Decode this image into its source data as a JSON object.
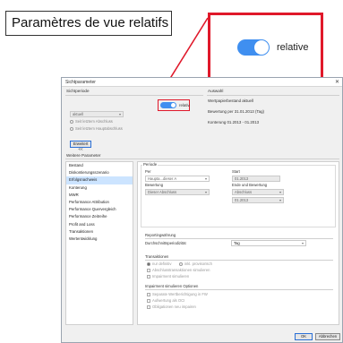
{
  "callout": {
    "title": "Paramètres de vue relatifs"
  },
  "zoom": {
    "toggle_label": "relative"
  },
  "dialog": {
    "title": "Sichtparameter",
    "sichtperiode_label": "Sichtperiode",
    "toggle_label": "relativ",
    "period_select_value": "aktuell",
    "radio_1": "Seit letztem Abschluss",
    "radio_2": "Seit letztem Hauptabschluss",
    "erweitert_button": "Erweitert <<",
    "auswahl_label": "Auswahl",
    "auswahl_lines": [
      "Wertpapierbestand aktuell",
      "Bewertung per 31.01.2013 (Tag)",
      "Konterung 01.2013 - 01.2013"
    ],
    "weitere_label": "Weitere Parameter",
    "ok_button": "OK",
    "cancel_button": "Abbrechen"
  },
  "nav": {
    "items": [
      "Bestand",
      "Diskontierungsszenario",
      "Erfolgsnachweis",
      "Konterung",
      "MWR",
      "Performance Attribution",
      "Performance Quervergleich",
      "Performance Zeitreihe",
      "Profit and Loss",
      "Transaktionen",
      "Wertentwicklung"
    ],
    "active_index": 2
  },
  "content": {
    "periode_title": "Periode",
    "per_label": "Per",
    "per_value": "Haupta...dieser A",
    "bewertung_label": "Bewertung",
    "bewertung_value": "Dieser Abschluss",
    "start_label": "Start",
    "start_value": "01.2013",
    "ende_label": "Ende und Bewertung",
    "ende_select": "Abschluss",
    "ende_value": "01.2013",
    "reporting_title": "Reportingwährung",
    "durchschnitt_label": "Durchschnittsperiodizität",
    "durchschnitt_value": "Tag",
    "transaktionen_title": "Transaktionen",
    "trans_radio_1": "nur definitiv",
    "trans_radio_2": "inkl. provisorisch",
    "trans_check_1": "Abschlusstransaktionen simulieren",
    "trans_check_2": "Impairment simulieren",
    "impairment_title": "Impairment simulieren Optionen",
    "imp_check_1": "Separate Wertberichtigung in FW",
    "imp_check_2": "Aufwertung als OCI",
    "imp_check_3": "Obligationen neu impairen"
  },
  "colors": {
    "accent": "#3f8ff0",
    "highlight": "#e0182a"
  }
}
